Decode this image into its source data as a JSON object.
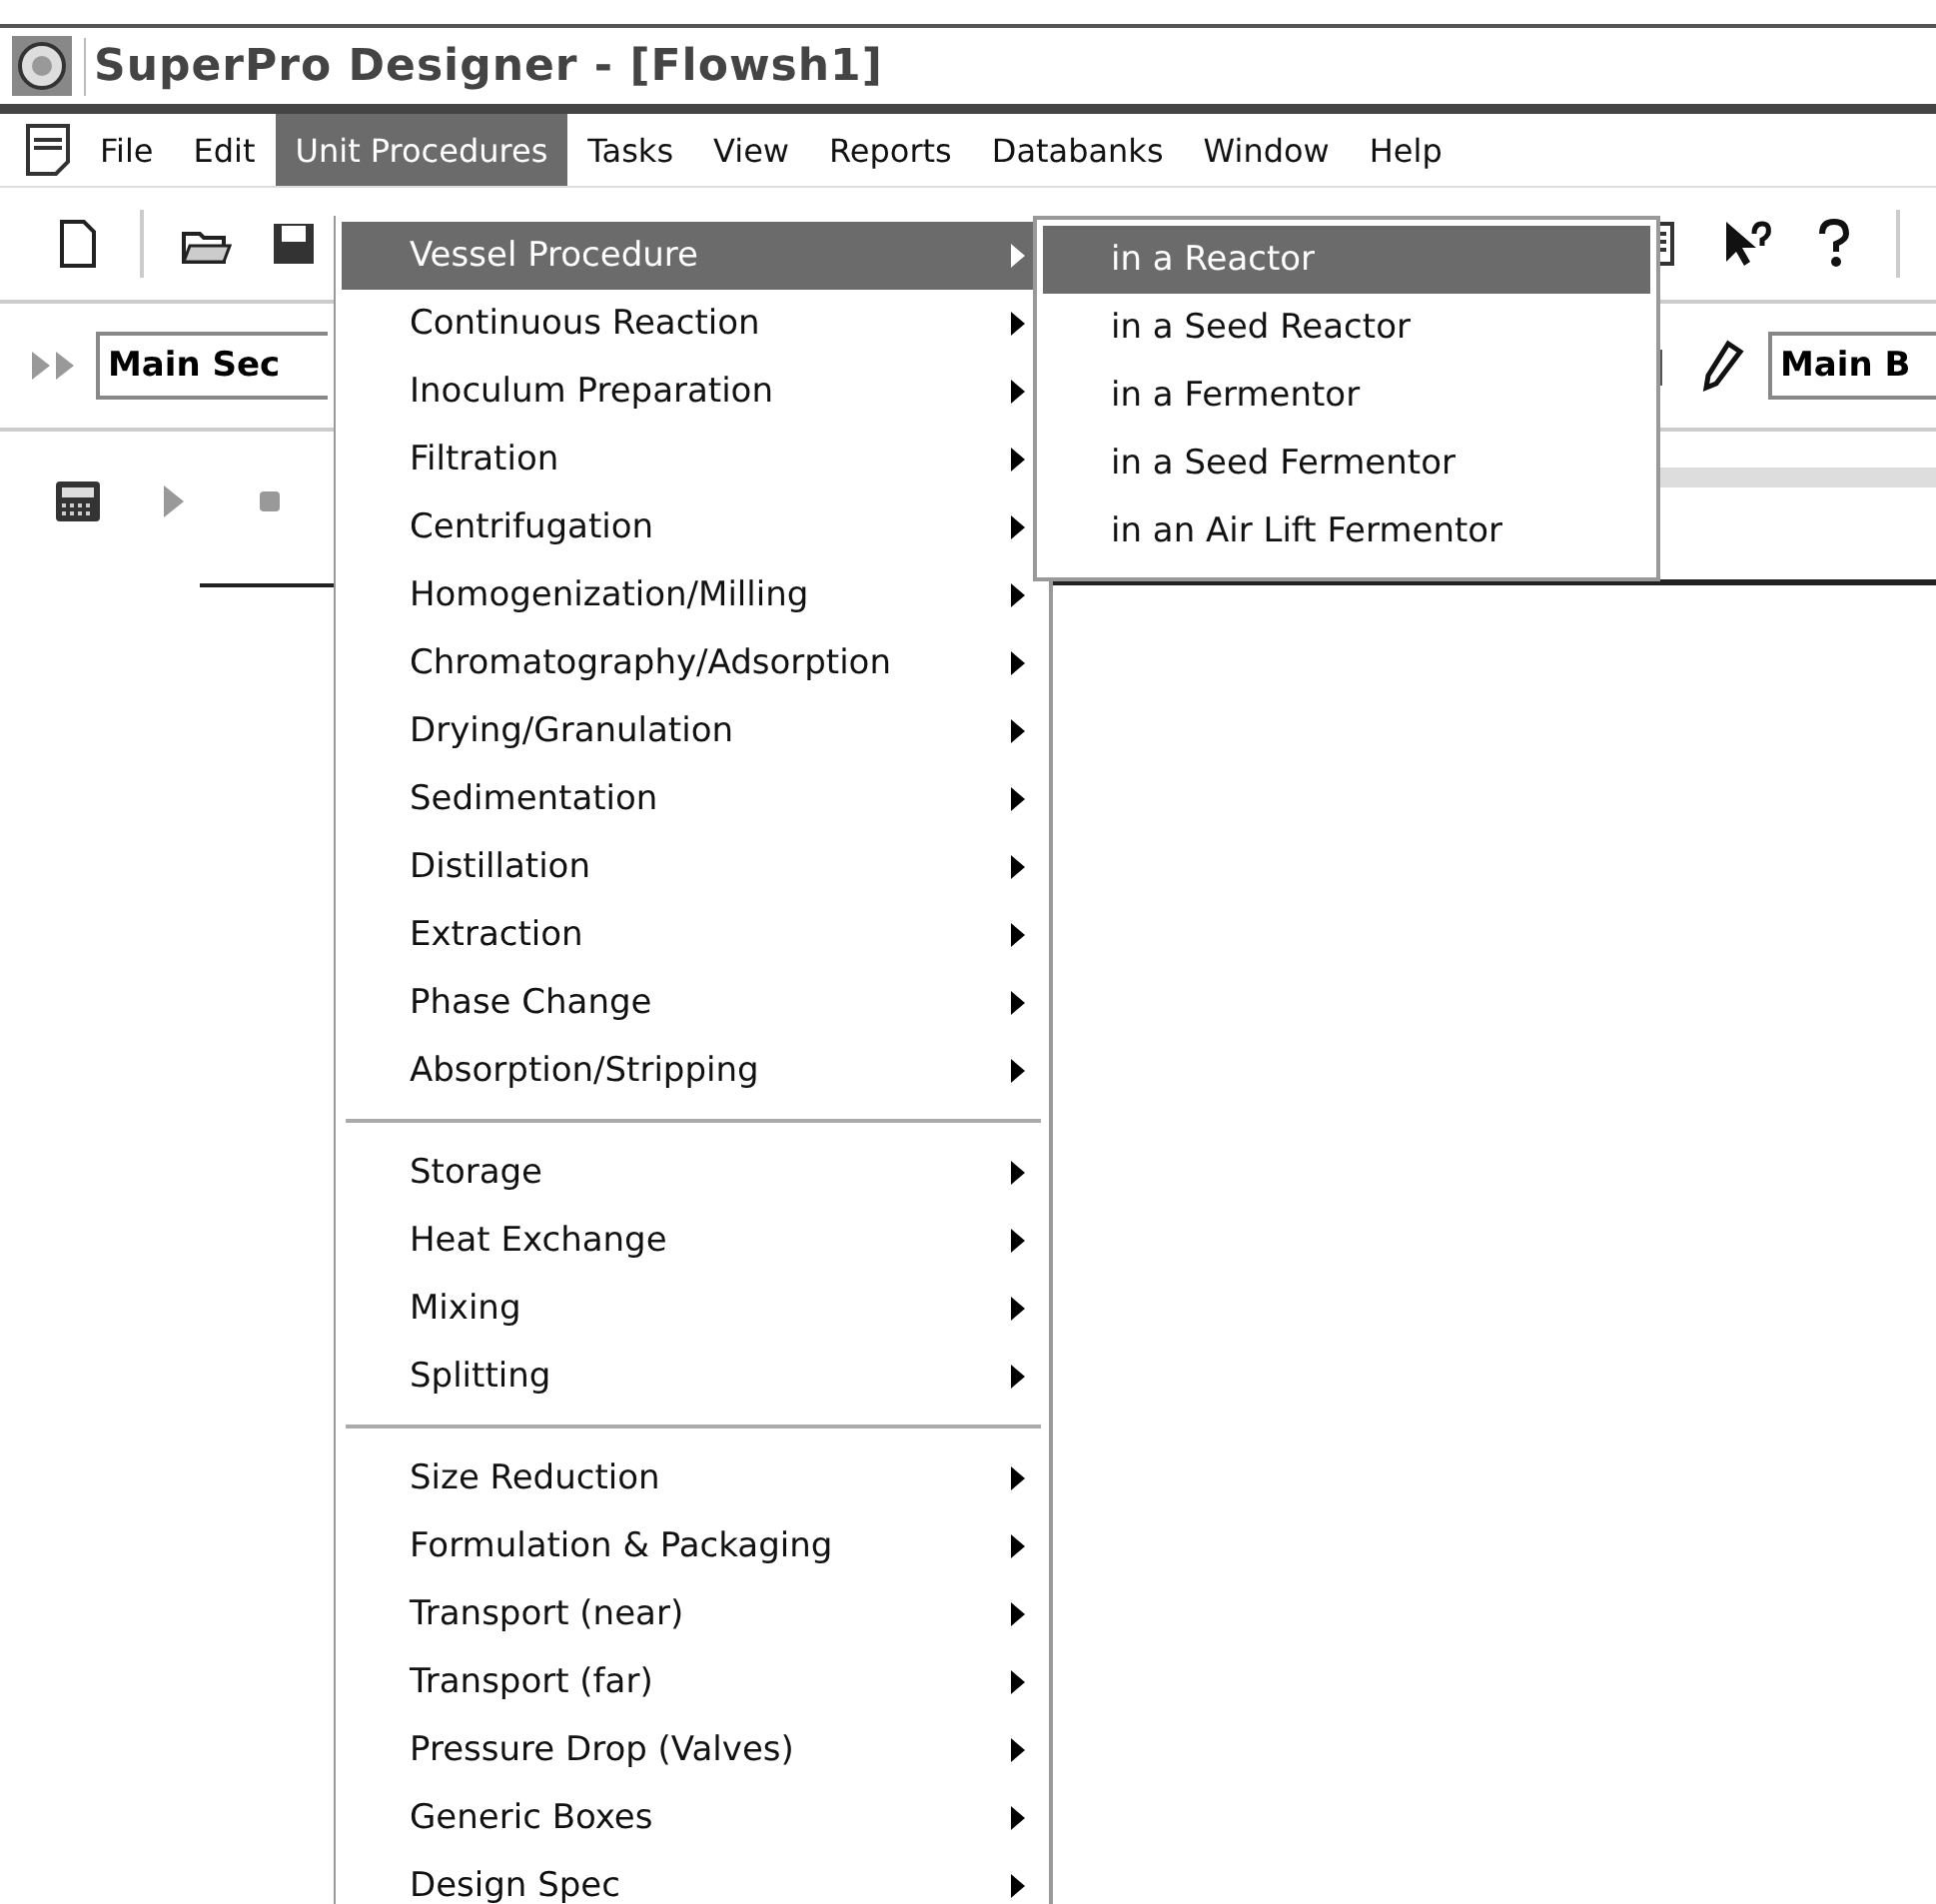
{
  "window": {
    "title": "SuperPro Designer - [Flowsh1]"
  },
  "menu_bar": [
    {
      "label": "File",
      "selected": false
    },
    {
      "label": "Edit",
      "selected": false
    },
    {
      "label": "Unit Procedures",
      "selected": true
    },
    {
      "label": "Tasks",
      "selected": false
    },
    {
      "label": "View",
      "selected": false
    },
    {
      "label": "Reports",
      "selected": false
    },
    {
      "label": "Databanks",
      "selected": false
    },
    {
      "label": "Window",
      "selected": false
    },
    {
      "label": "Help",
      "selected": false
    }
  ],
  "section_field": {
    "value": "Main Sec"
  },
  "branch_field": {
    "value": "Main B"
  },
  "menu": {
    "groups": [
      {
        "items": [
          {
            "label": "Vessel Procedure",
            "selected": true
          },
          {
            "label": "Continuous Reaction",
            "selected": false
          },
          {
            "label": "Inoculum Preparation",
            "selected": false
          },
          {
            "label": "Filtration",
            "selected": false
          },
          {
            "label": "Centrifugation",
            "selected": false
          },
          {
            "label": "Homogenization/Milling",
            "selected": false
          },
          {
            "label": "Chromatography/Adsorption",
            "selected": false
          },
          {
            "label": "Drying/Granulation",
            "selected": false
          },
          {
            "label": "Sedimentation",
            "selected": false
          },
          {
            "label": "Distillation",
            "selected": false
          },
          {
            "label": "Extraction",
            "selected": false
          },
          {
            "label": "Phase Change",
            "selected": false
          },
          {
            "label": "Absorption/Stripping",
            "selected": false
          }
        ]
      },
      {
        "items": [
          {
            "label": "Storage",
            "selected": false
          },
          {
            "label": "Heat Exchange",
            "selected": false
          },
          {
            "label": "Mixing",
            "selected": false
          },
          {
            "label": "Splitting",
            "selected": false
          }
        ]
      },
      {
        "items": [
          {
            "label": "Size Reduction",
            "selected": false
          },
          {
            "label": "Formulation & Packaging",
            "selected": false
          },
          {
            "label": "Transport (near)",
            "selected": false
          },
          {
            "label": "Transport (far)",
            "selected": false
          },
          {
            "label": "Pressure Drop (Valves)",
            "selected": false
          },
          {
            "label": "Generic Boxes",
            "selected": false
          },
          {
            "label": "Design Spec",
            "selected": false
          }
        ]
      }
    ]
  },
  "submenu": {
    "items": [
      {
        "label": "in a Reactor",
        "selected": true
      },
      {
        "label": "in a Seed Reactor",
        "selected": false
      },
      {
        "label": "in a Fermentor",
        "selected": false
      },
      {
        "label": "in a Seed Fermentor",
        "selected": false
      },
      {
        "label": "in an Air Lift Fermentor",
        "selected": false
      }
    ]
  }
}
